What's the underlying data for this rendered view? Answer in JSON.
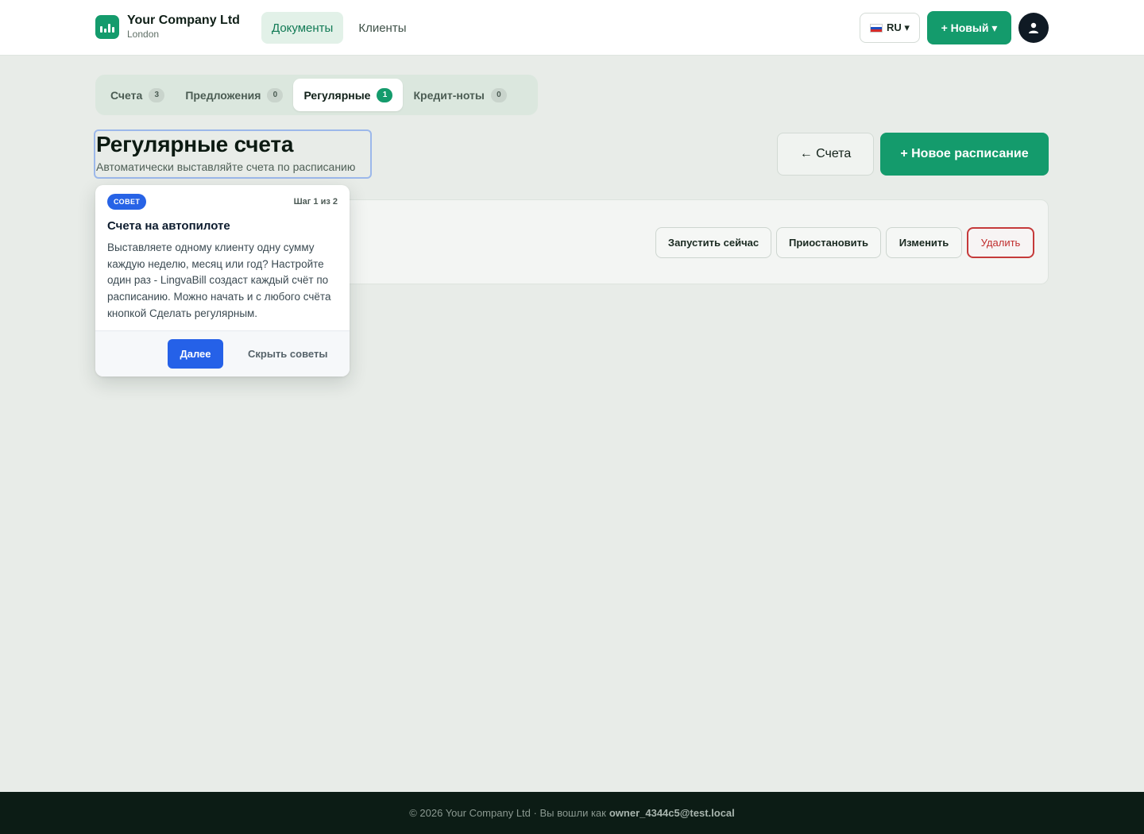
{
  "header": {
    "company_name": "Your Company Ltd",
    "company_city": "London",
    "nav": [
      {
        "label": "Документы",
        "active": true
      },
      {
        "label": "Клиенты",
        "active": false
      }
    ],
    "language": "RU ▾",
    "new_button": "+ Новый ▾",
    "avatar_icon": "user-icon"
  },
  "tabs": [
    {
      "label": "Счета",
      "count": "3",
      "active": false
    },
    {
      "label": "Предложения",
      "count": "0",
      "active": false
    },
    {
      "label": "Регулярные",
      "count": "1",
      "active": true
    },
    {
      "label": "Кредит-ноты",
      "count": "0",
      "active": false
    }
  ],
  "page": {
    "title": "Регулярные счета",
    "subtitle": "Автоматически выставляйте счета по расписанию",
    "back_button": "← Счета",
    "new_schedule_button": "+ Новое расписание"
  },
  "row_actions": {
    "run_now": "Запустить сейчас",
    "pause": "Приостановить",
    "edit": "Изменить",
    "delete": "Удалить"
  },
  "tip": {
    "badge": "СОВЕТ",
    "step": "Шаг 1 из 2",
    "title": "Счета на автопилоте",
    "body": "Выставляете одному клиенту одну сумму каждую неделю, месяц или год? Настройте один раз - LingvaBill создаст каждый счёт по расписанию. Можно начать и с любого счёта кнопкой Сделать регулярным.",
    "next_button": "Далее",
    "hide_button": "Скрыть советы"
  },
  "footer": {
    "text": "© 2026 Your Company Ltd · Вы вошли как",
    "user": "owner_4344c5@test.local"
  },
  "colors": {
    "brand_green": "#149b6c",
    "tip_blue": "#2763e6",
    "danger_red": "#c53a3a",
    "footer_bg": "#0c1c15"
  }
}
